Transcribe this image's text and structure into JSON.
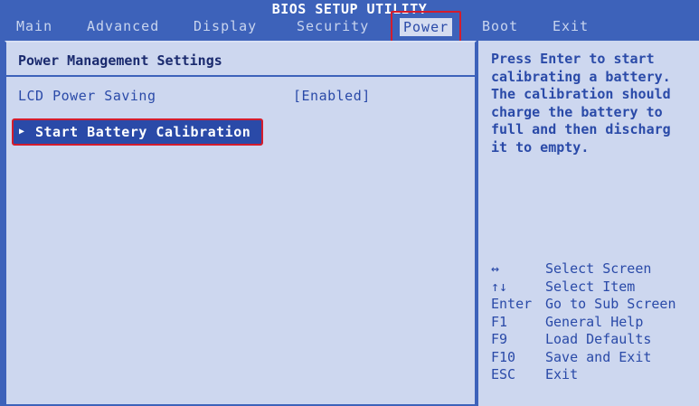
{
  "title": "BIOS SETUP UTILITY",
  "menu": [
    {
      "label": "Main",
      "active": false
    },
    {
      "label": "Advanced",
      "active": false
    },
    {
      "label": "Display",
      "active": false
    },
    {
      "label": "Security",
      "active": false
    },
    {
      "label": "Power",
      "active": true
    },
    {
      "label": "Boot",
      "active": false
    },
    {
      "label": "Exit",
      "active": false
    }
  ],
  "main": {
    "section_title": "Power Management Settings",
    "lcd_power_saving": {
      "label": "LCD Power Saving",
      "value": "[Enabled]"
    },
    "battery_calibration": {
      "arrow": "▶",
      "label": "Start Battery Calibration"
    }
  },
  "help": {
    "text": "Press Enter to start\ncalibrating a battery.\nThe calibration should\ncharge the battery to\nfull and then discharg\nit to empty.",
    "keys": [
      {
        "key": "↔",
        "desc": "Select Screen"
      },
      {
        "key": "↑↓",
        "desc": "Select Item"
      },
      {
        "key": "Enter",
        "desc": "Go to Sub Screen"
      },
      {
        "key": "F1",
        "desc": "General Help"
      },
      {
        "key": "F9",
        "desc": "Load Defaults"
      },
      {
        "key": "F10",
        "desc": "Save and Exit"
      },
      {
        "key": "ESC",
        "desc": "Exit"
      }
    ]
  },
  "colors": {
    "background": "#3d62ba",
    "panel": "#cdd7ef",
    "text": "#2a4aa8",
    "highlight_outline": "#d41c2c"
  }
}
